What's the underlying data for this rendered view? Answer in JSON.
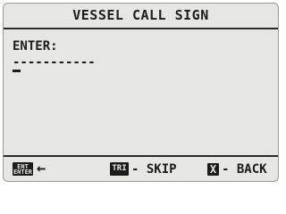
{
  "screen": {
    "title": "VESSEL CALL SIGN",
    "prompt": "ENTER:",
    "entry_field": "-----------",
    "soft_keys": [
      {
        "icon_top": "ENT",
        "icon_bottom": "ENTER",
        "label": "←"
      },
      {
        "icon": "TRI",
        "label": "- SKIP"
      },
      {
        "icon": "X",
        "label": "- BACK"
      }
    ]
  }
}
